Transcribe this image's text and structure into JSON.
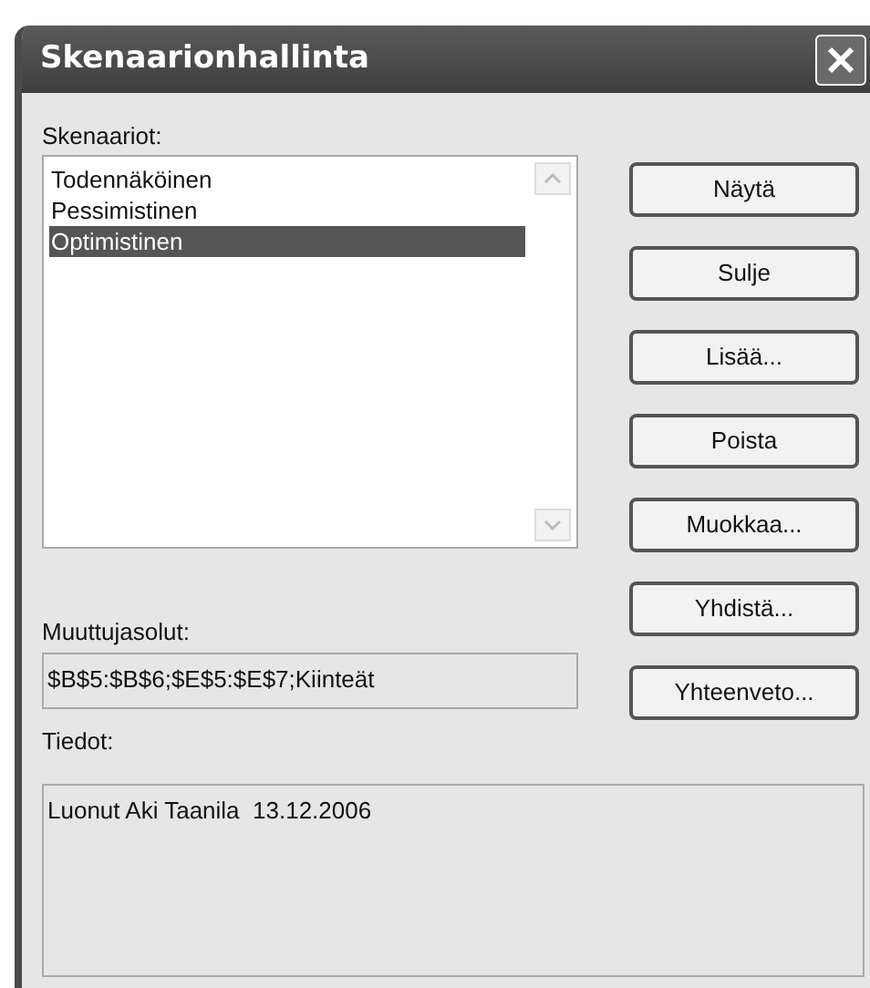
{
  "window": {
    "title": "Skenaarionhallinta"
  },
  "scenarios": {
    "label": "Skenaariot:",
    "items": [
      {
        "label": "Todennäköinen",
        "selected": false
      },
      {
        "label": "Pessimistinen",
        "selected": false
      },
      {
        "label": "Optimistinen",
        "selected": true
      }
    ]
  },
  "buttons": [
    "Näytä",
    "Sulje",
    "Lisää...",
    "Poista",
    "Muokkaa...",
    "Yhdistä...",
    "Yhteenveto..."
  ],
  "changing_cells": {
    "label": "Muuttujasolut:",
    "value": "$B$5:$B$6;$E$5:$E$7;Kiinteät"
  },
  "info": {
    "label": "Tiedot:",
    "value": "Luonut Aki Taanila  13.12.2006"
  }
}
